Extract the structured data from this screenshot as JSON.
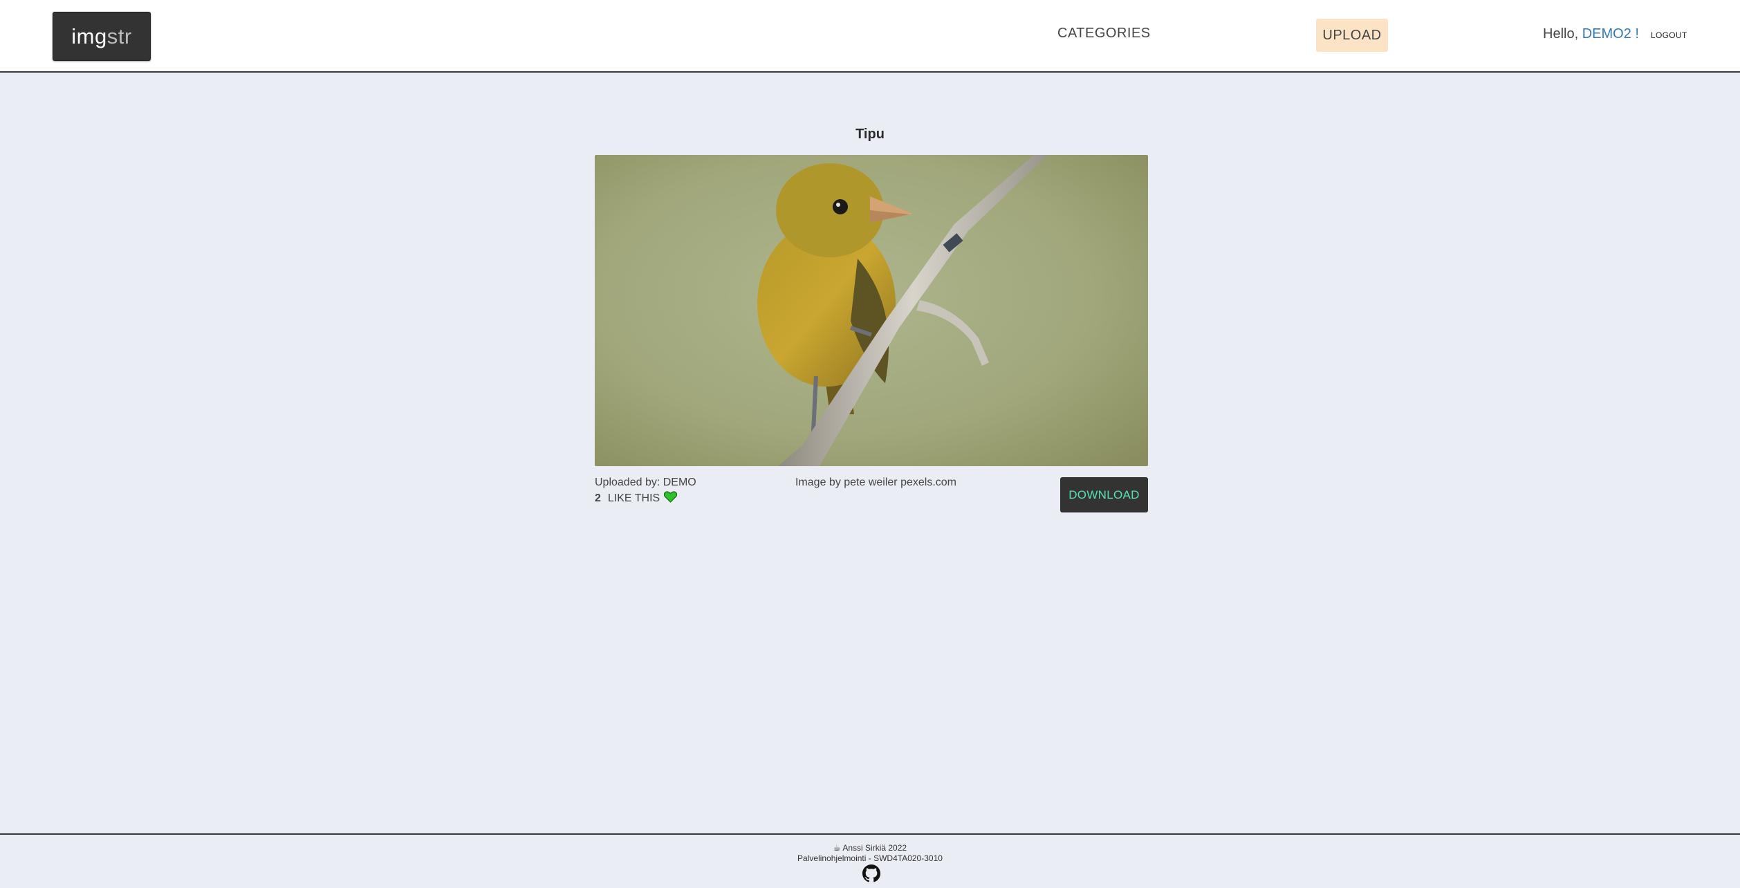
{
  "header": {
    "logo": {
      "part_a": "img",
      "part_b": "str"
    },
    "nav": {
      "categories_label": "CATEGORIES",
      "upload_label": "UPLOAD"
    },
    "greeting": {
      "prefix": "Hello, ",
      "username": "DEMO2",
      "suffix": " !"
    },
    "logout_label": "LOGOUT"
  },
  "image_view": {
    "title": "Tipu",
    "uploaded_by": "Uploaded by: DEMO",
    "like_count": "2",
    "like_label": "LIKE THIS",
    "credit": "Image by pete weiler pexels.com",
    "download_label": "DOWNLOAD"
  },
  "footer": {
    "line1": "Anssi Sirkiä 2022",
    "line2": "Palvelinohjelmointi - SWD4TA020-3010",
    "icons": [
      "coffee-icon",
      "github-icon"
    ]
  },
  "colors": {
    "background": "#eaedf4",
    "header_bg": "#ffffff",
    "logo_bg": "#333333",
    "upload_bg": "#fce3c6",
    "username": "#2e7ab8",
    "download_text": "#55e3b3",
    "heart": "#2fbf2f"
  }
}
